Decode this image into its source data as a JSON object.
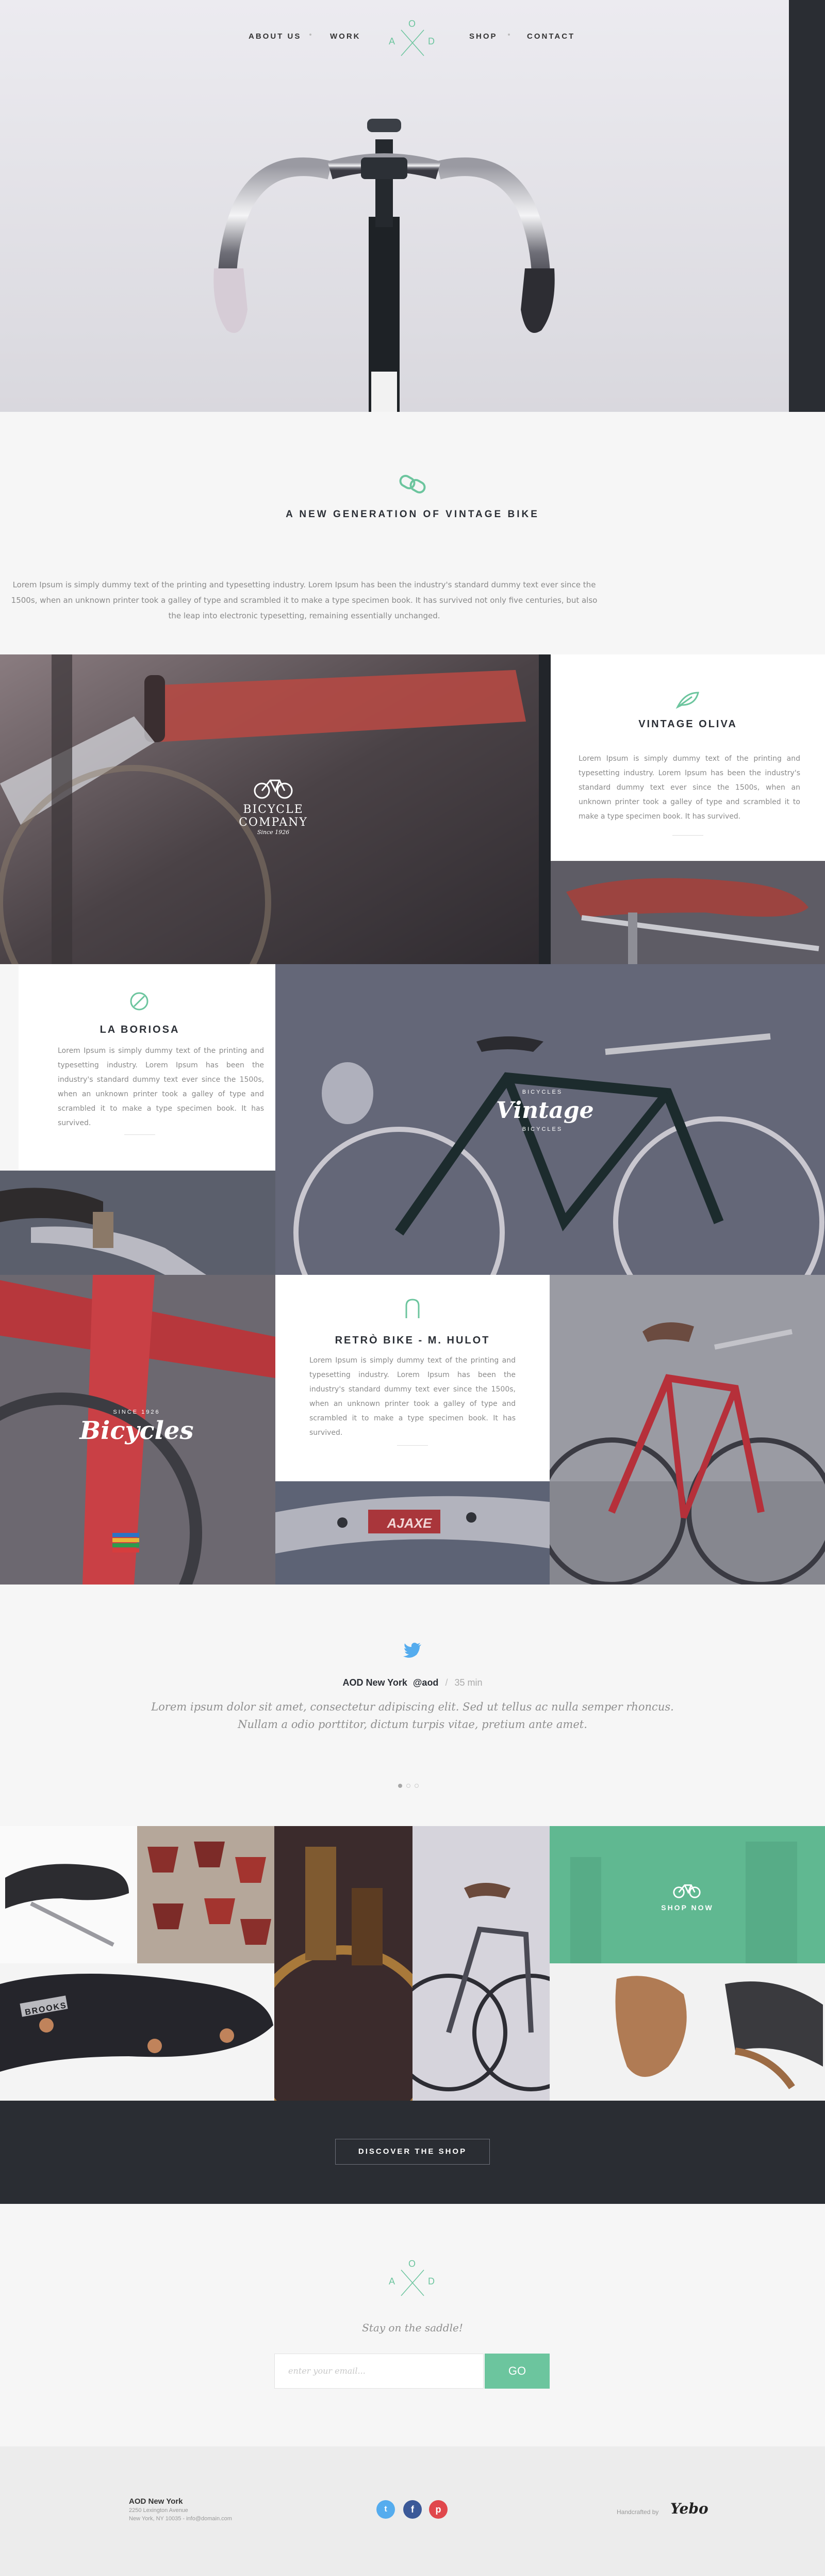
{
  "nav": {
    "left_items": [
      "ABOUT US",
      "WORK"
    ],
    "right_items": [
      "SHOP",
      "CONTACT"
    ],
    "logo_letters": [
      "A",
      "O",
      "D"
    ]
  },
  "intro": {
    "heading": "A NEW GENERATION OF VINTAGE BIKE",
    "text": "Lorem Ipsum is simply dummy text of the printing and typesetting industry. Lorem Ipsum has been the industry's standard dummy text ever since the 1500s, when an unknown printer took a galley of type and scrambled it to make a type specimen book. It has survived not only five centuries, but also the leap into electronic typesetting, remaining essentially unchanged."
  },
  "cards": [
    {
      "title": "VINTAGE OLIVA",
      "text": "Lorem Ipsum is simply dummy text of the printing and typesetting industry. Lorem Ipsum has been the industry's standard dummy text ever since the 1500s, when an unknown printer took a galley of type and scrambled it to make a type specimen book. It has survived."
    },
    {
      "title": "LA BORIOSA",
      "text": "Lorem Ipsum is simply dummy text of the printing and typesetting industry. Lorem Ipsum has been the industry's standard dummy text ever since the 1500s, when an unknown printer took a galley of type and scrambled it to make a type specimen book. It has survived."
    },
    {
      "title": "RETRÒ BIKE - M. HULOT",
      "text": "Lorem Ipsum is simply dummy text of the printing and typesetting industry. Lorem Ipsum has been the industry's standard dummy text ever since the 1500s, when an unknown printer took a galley of type and scrambled it to make a type specimen book. It has survived."
    }
  ],
  "photo_badges": {
    "bicycle_company": [
      "BICYCLE",
      "COMPANY",
      "Since 1926"
    ],
    "vintage": [
      "BICYCLES",
      "Vintage",
      "BICYCLES"
    ],
    "bicycles": [
      "SINCE 1926",
      "Bicycles"
    ],
    "ajaxe": "AJAXE",
    "brooks": "BROOKS"
  },
  "tweet": {
    "author": "AOD New York",
    "handle": "@aod",
    "separator": "/",
    "time": "35 min",
    "text": "Lorem ipsum dolor sit amet, consectetur adipiscing elit. Sed ut tellus ac nulla semper rhoncus. Nullam a odio porttitor, dictum turpis vitae, pretium ante amet."
  },
  "shop": {
    "shop_now": "SHOP NOW",
    "discover": "DISCOVER THE SHOP"
  },
  "newsletter": {
    "tagline": "Stay on the saddle!",
    "placeholder": "enter your email...",
    "go": "GO"
  },
  "footer": {
    "company": "AOD New York",
    "address1": "2250 Lexington Avenue",
    "address2": "New York, NY 10035 - info@domain.com",
    "handcrafted": "Handcrafted by",
    "signature": "Yebo"
  },
  "colors": {
    "accent": "#6cc59e",
    "dark": "#2a2d33",
    "twitter": "#55acee",
    "facebook": "#3b5998",
    "pinterest": "#e0474c"
  },
  "icons": {
    "intro": "chain-link-icon",
    "card1": "leaf-icon",
    "card2": "compass-icon",
    "card3": "hook-icon",
    "tweet": "twitter-icon",
    "bike": "bicycle-icon",
    "social": [
      "twitter-icon",
      "facebook-icon",
      "pinterest-icon"
    ]
  }
}
